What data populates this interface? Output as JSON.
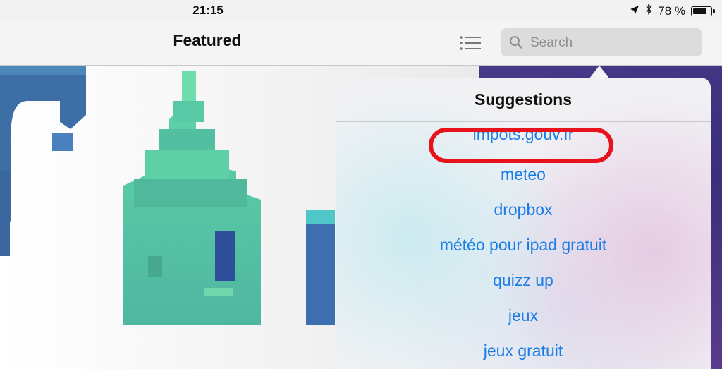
{
  "status_bar": {
    "time": "21:15",
    "battery_text": "78 %",
    "battery_level": 0.78
  },
  "nav": {
    "title": "Featured",
    "search_placeholder": "Search"
  },
  "popover": {
    "title": "Suggestions",
    "items": [
      "impots.gouv.fr",
      "meteo",
      "dropbox",
      "météo pour ipad gratuit",
      "quizz up",
      "jeux",
      "jeux gratuit"
    ],
    "highlight_color": "#e8121b"
  },
  "colors": {
    "accent": "#1a7de6"
  }
}
